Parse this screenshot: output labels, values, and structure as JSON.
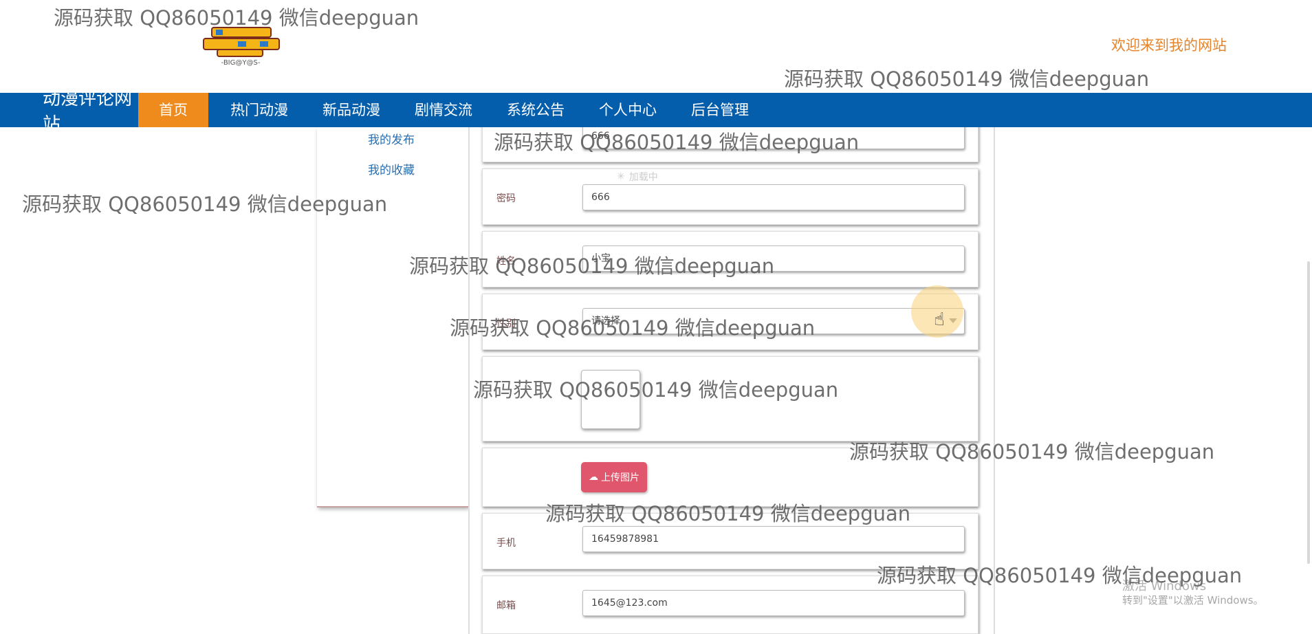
{
  "header": {
    "welcome_text": "欢迎来到我的网站"
  },
  "nav": {
    "brand": "动漫评论网站",
    "items": [
      "首页",
      "热门动漫",
      "新品动漫",
      "剧情交流",
      "系统公告",
      "个人中心",
      "后台管理"
    ],
    "active_index": 0
  },
  "sidebar": {
    "items": [
      "我的发布",
      "我的收藏"
    ]
  },
  "form": {
    "account": {
      "value": "666"
    },
    "password": {
      "label": "密码",
      "value": "666"
    },
    "name": {
      "label": "姓名",
      "value": "小宝"
    },
    "gender": {
      "label": "性别",
      "value": "请选择"
    },
    "upload_button": "上传图片",
    "phone": {
      "label": "手机",
      "value": "16459878981"
    },
    "email": {
      "label": "邮箱",
      "value": "1645@123.com"
    }
  },
  "loading_text": "加载中",
  "watermark_text": "源码获取 QQ86050149 微信deepguan",
  "os_notice": {
    "title": "激活 Windows",
    "subtitle": "转到\"设置\"以激活 Windows。"
  },
  "colors": {
    "nav_bg": "#045eac",
    "nav_active": "#ef8a1c",
    "welcome": "#e6842a",
    "upload_btn": "#e0566c"
  },
  "icons": {
    "cursor": "hand-cursor-icon",
    "upload": "cloud-upload-icon",
    "loading": "spinner-icon"
  }
}
